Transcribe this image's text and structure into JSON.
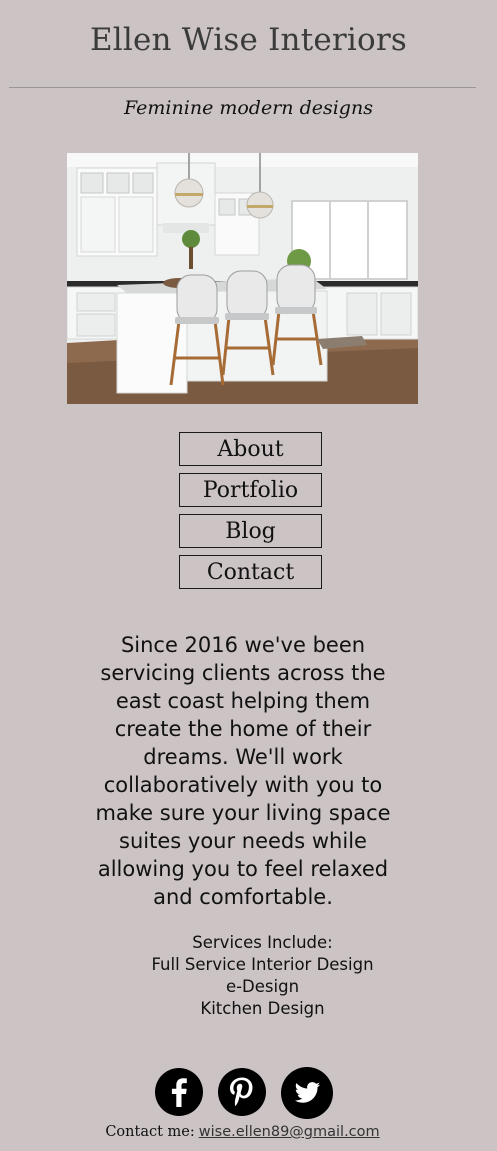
{
  "header": {
    "title": "Ellen Wise Interiors",
    "tagline": "Feminine modern designs"
  },
  "hero": {
    "image": "kitchen-photo"
  },
  "nav": {
    "items": [
      {
        "label": "About"
      },
      {
        "label": "Portfolio"
      },
      {
        "label": "Blog"
      },
      {
        "label": "Contact"
      }
    ]
  },
  "intro": {
    "text": "Since 2016 we've been servicing clients across the east coast helping them create the home of their dreams. We'll work collaboratively with you to make sure your living space suites your needs while allowing you to feel relaxed and comfortable."
  },
  "services": {
    "heading": "Services Include:",
    "items": [
      "Full Service Interior Design",
      "e-Design",
      "Kitchen Design"
    ]
  },
  "social": {
    "icons": [
      "facebook-icon",
      "pinterest-icon",
      "twitter-icon"
    ]
  },
  "contact": {
    "label": "Contact me:",
    "email": "wise.ellen89@gmail.com"
  },
  "colors": {
    "background": "#cbc3c4",
    "text": "#111111"
  }
}
